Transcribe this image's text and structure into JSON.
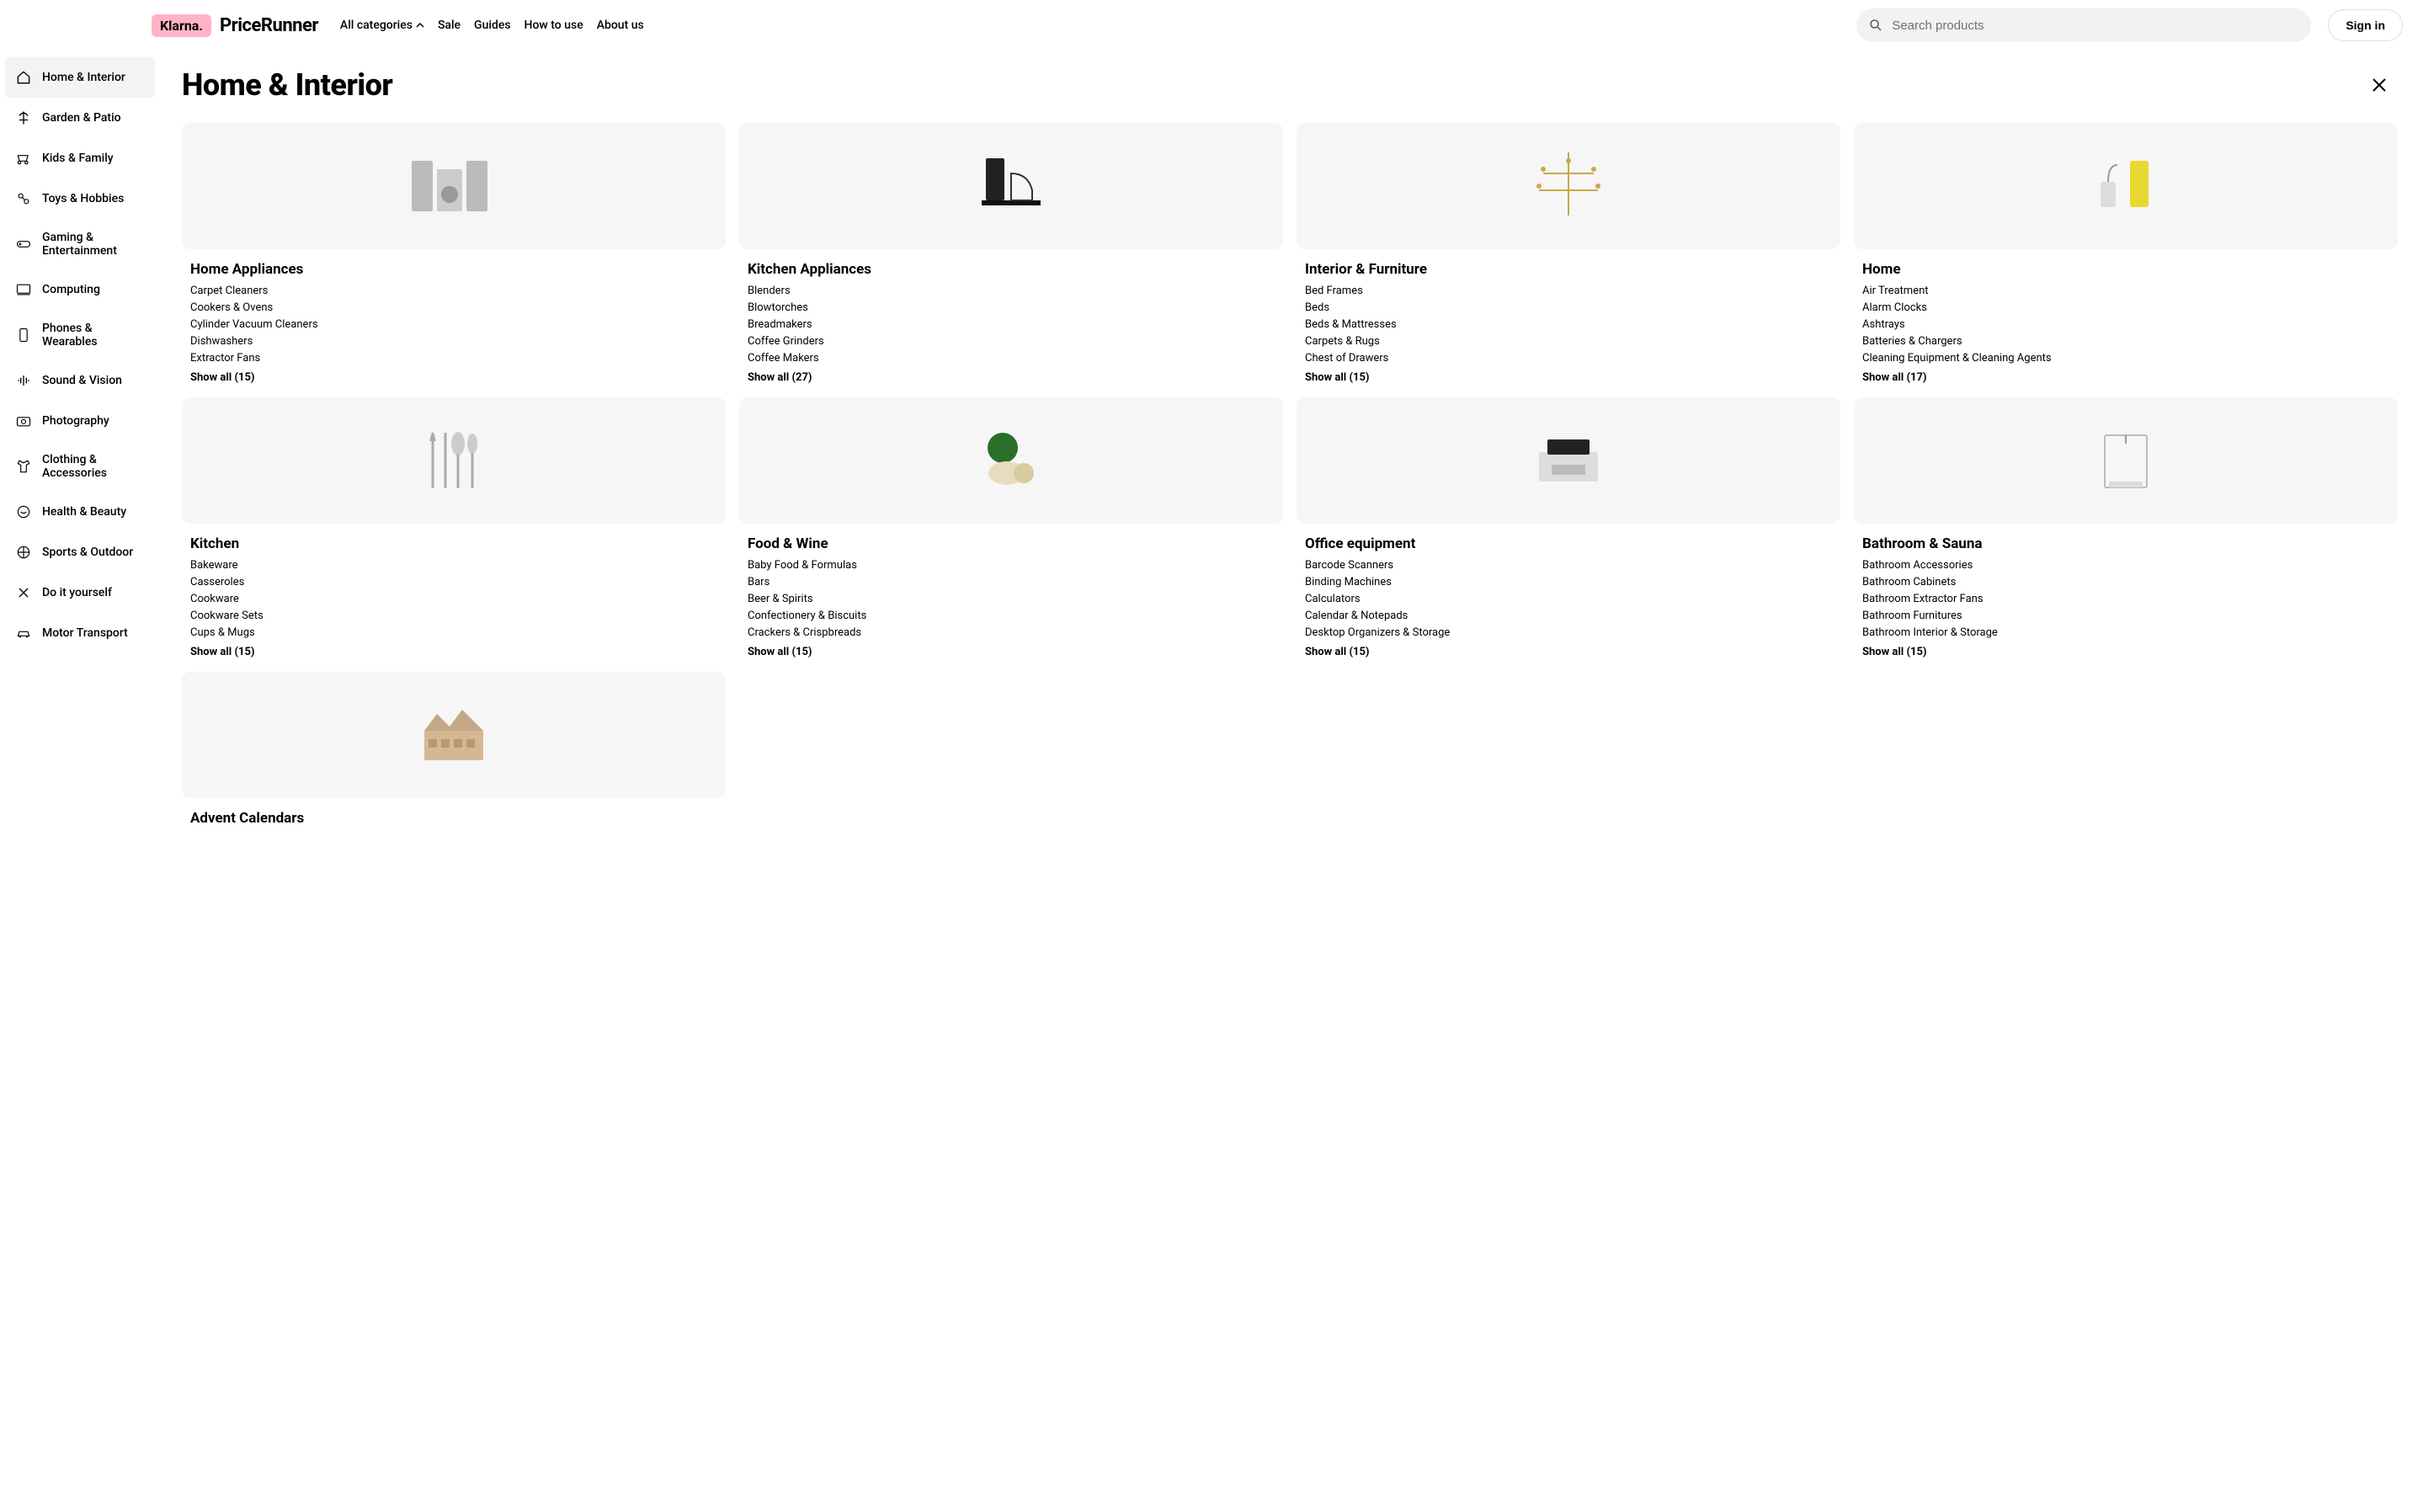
{
  "header": {
    "badge": "Klarna.",
    "brand": "PriceRunner",
    "nav": {
      "all_categories": "All categories",
      "sale": "Sale",
      "guides": "Guides",
      "how_to_use": "How to use",
      "about_us": "About us"
    },
    "search_placeholder": "Search products",
    "signin": "Sign in"
  },
  "sidebar": {
    "items": [
      {
        "label": "Home & Interior",
        "active": true,
        "icon": "home"
      },
      {
        "label": "Garden & Patio",
        "icon": "garden"
      },
      {
        "label": "Kids & Family",
        "icon": "kids"
      },
      {
        "label": "Toys & Hobbies",
        "icon": "toys"
      },
      {
        "label": "Gaming & Entertainment",
        "icon": "gaming"
      },
      {
        "label": "Computing",
        "icon": "computing"
      },
      {
        "label": "Phones & Wearables",
        "icon": "phone"
      },
      {
        "label": "Sound & Vision",
        "icon": "sound"
      },
      {
        "label": "Photography",
        "icon": "photo"
      },
      {
        "label": "Clothing & Accessories",
        "icon": "clothing"
      },
      {
        "label": "Health & Beauty",
        "icon": "health"
      },
      {
        "label": "Sports & Outdoor",
        "icon": "sports"
      },
      {
        "label": "Do it yourself",
        "icon": "diy"
      },
      {
        "label": "Motor Transport",
        "icon": "motor"
      }
    ]
  },
  "page_title": "Home & Interior",
  "cards": [
    {
      "title": "Home Appliances",
      "links": [
        "Carpet Cleaners",
        "Cookers & Ovens",
        "Cylinder Vacuum Cleaners",
        "Dishwashers",
        "Extractor Fans"
      ],
      "show_all": "Show all (15)",
      "img": "appliances"
    },
    {
      "title": "Kitchen Appliances",
      "links": [
        "Blenders",
        "Blowtorches",
        "Breadmakers",
        "Coffee Grinders",
        "Coffee Makers"
      ],
      "show_all": "Show all (27)",
      "img": "coffee"
    },
    {
      "title": "Interior & Furniture",
      "links": [
        "Bed Frames",
        "Beds",
        "Beds & Mattresses",
        "Carpets & Rugs",
        "Chest of Drawers"
      ],
      "show_all": "Show all (15)",
      "img": "chandelier"
    },
    {
      "title": "Home",
      "links": [
        "Air Treatment",
        "Alarm Clocks",
        "Ashtrays",
        "Batteries & Chargers",
        "Cleaning Equipment & Cleaning Agents"
      ],
      "show_all": "Show all (17)",
      "img": "vacuum"
    },
    {
      "title": "Kitchen",
      "links": [
        "Bakeware",
        "Casseroles",
        "Cookware",
        "Cookware Sets",
        "Cups & Mugs"
      ],
      "show_all": "Show all (15)",
      "img": "cutlery"
    },
    {
      "title": "Food & Wine",
      "links": [
        "Baby Food & Formulas",
        "Bars",
        "Beer & Spirits",
        "Confectionery & Biscuits",
        "Crackers & Crispbreads"
      ],
      "show_all": "Show all (15)",
      "img": "food"
    },
    {
      "title": "Office equipment",
      "links": [
        "Barcode Scanners",
        "Binding Machines",
        "Calculators",
        "Calendar & Notepads",
        "Desktop Organizers & Storage"
      ],
      "show_all": "Show all (15)",
      "img": "printer"
    },
    {
      "title": "Bathroom & Sauna",
      "links": [
        "Bathroom Accessories",
        "Bathroom Cabinets",
        "Bathroom Extractor Fans",
        "Bathroom Furnitures",
        "Bathroom Interior & Storage"
      ],
      "show_all": "Show all (15)",
      "img": "shower"
    },
    {
      "title": "Advent Calendars",
      "links": [],
      "show_all": "",
      "img": "advent"
    }
  ]
}
